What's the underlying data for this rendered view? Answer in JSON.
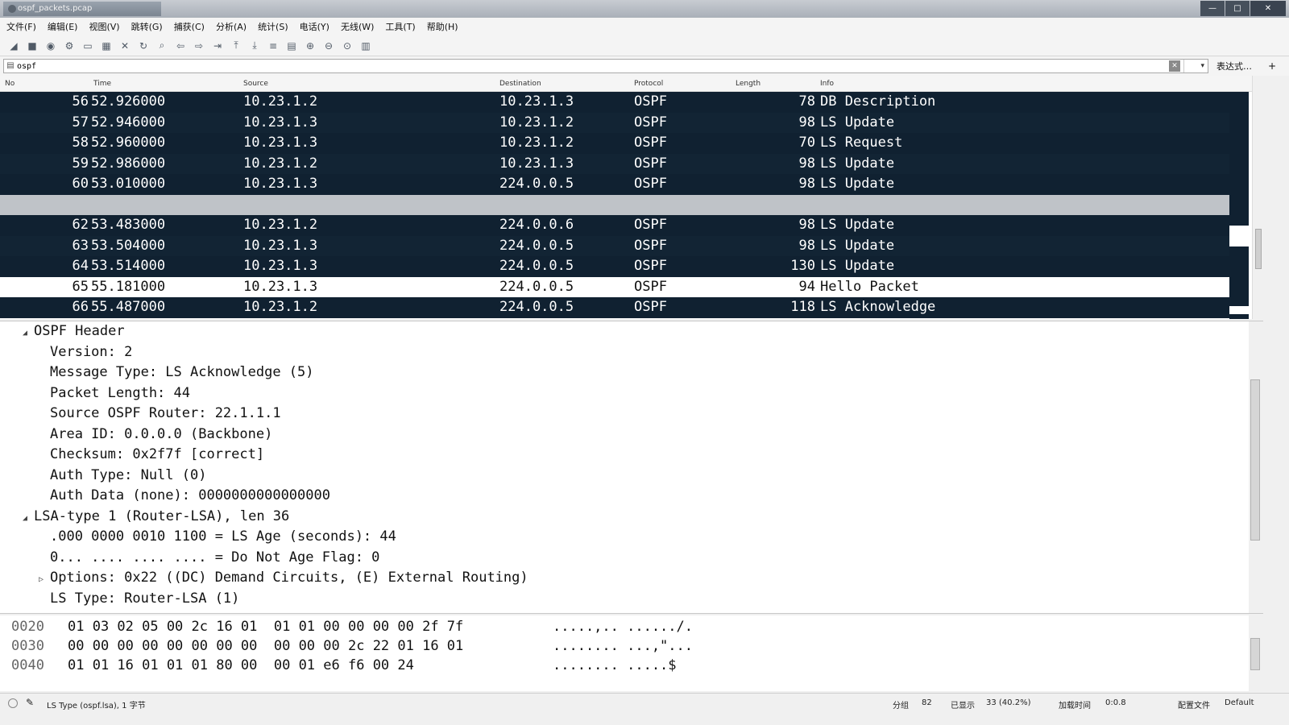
{
  "window": {
    "title": "ospf_packets.pcap",
    "controls": {
      "minimize": "—",
      "maximize": "□",
      "close": "✕"
    }
  },
  "menu": {
    "items": [
      "文件(F)",
      "编辑(E)",
      "视图(V)",
      "跳转(G)",
      "捕获(C)",
      "分析(A)",
      "统计(S)",
      "电话(Y)",
      "无线(W)",
      "工具(T)",
      "帮助(H)"
    ]
  },
  "filter": {
    "value": "ospf",
    "expression_label": "表达式…",
    "plus_label": "+"
  },
  "packet_list": {
    "columns": {
      "no": "No",
      "time": "Time",
      "source": "Source",
      "destination": "Destination",
      "protocol": "Protocol",
      "length": "Length",
      "info": "Info"
    },
    "rows": [
      {
        "no": "56",
        "time": "52.926000",
        "source": "10.23.1.2",
        "destination": "10.23.1.3",
        "protocol": "OSPF",
        "length": "78",
        "info": "DB Description"
      },
      {
        "no": "57",
        "time": "52.946000",
        "source": "10.23.1.3",
        "destination": "10.23.1.2",
        "protocol": "OSPF",
        "length": "98",
        "info": "LS Update"
      },
      {
        "no": "58",
        "time": "52.960000",
        "source": "10.23.1.3",
        "destination": "10.23.1.2",
        "protocol": "OSPF",
        "length": "70",
        "info": "LS Request"
      },
      {
        "no": "59",
        "time": "52.986000",
        "source": "10.23.1.2",
        "destination": "10.23.1.3",
        "protocol": "OSPF",
        "length": "98",
        "info": "LS Update"
      },
      {
        "no": "60",
        "time": "53.010000",
        "source": "10.23.1.3",
        "destination": "224.0.0.5",
        "protocol": "OSPF",
        "length": "98",
        "info": "LS Update"
      },
      {
        "no": "",
        "time": "",
        "source": "",
        "destination": "",
        "protocol": "",
        "length": "",
        "info": ""
      },
      {
        "no": "62",
        "time": "53.483000",
        "source": "10.23.1.2",
        "destination": "224.0.0.6",
        "protocol": "OSPF",
        "length": "98",
        "info": "LS Update"
      },
      {
        "no": "63",
        "time": "53.504000",
        "source": "10.23.1.3",
        "destination": "224.0.0.5",
        "protocol": "OSPF",
        "length": "98",
        "info": "LS Update"
      },
      {
        "no": "64",
        "time": "53.514000",
        "source": "10.23.1.3",
        "destination": "224.0.0.5",
        "protocol": "OSPF",
        "length": "130",
        "info": "LS Update"
      },
      {
        "no": "65",
        "time": "55.181000",
        "source": "10.23.1.3",
        "destination": "224.0.0.5",
        "protocol": "OSPF",
        "length": "94",
        "info": "Hello Packet"
      },
      {
        "no": "66",
        "time": "55.487000",
        "source": "10.23.1.2",
        "destination": "224.0.0.5",
        "protocol": "OSPF",
        "length": "118",
        "info": "LS Acknowledge"
      }
    ]
  },
  "details": {
    "lines": [
      {
        "indent": 1,
        "toggle": "◢",
        "text": "OSPF Header"
      },
      {
        "indent": 2,
        "toggle": "",
        "text": "Version: 2"
      },
      {
        "indent": 2,
        "toggle": "",
        "text": "Message Type: LS Acknowledge (5)"
      },
      {
        "indent": 2,
        "toggle": "",
        "text": "Packet Length: 44"
      },
      {
        "indent": 2,
        "toggle": "",
        "text": "Source OSPF Router: 22.1.1.1"
      },
      {
        "indent": 2,
        "toggle": "",
        "text": "Area ID: 0.0.0.0 (Backbone)"
      },
      {
        "indent": 2,
        "toggle": "",
        "text": "Checksum: 0x2f7f [correct]"
      },
      {
        "indent": 2,
        "toggle": "",
        "text": "Auth Type: Null (0)"
      },
      {
        "indent": 2,
        "toggle": "",
        "text": "Auth Data (none): 0000000000000000"
      },
      {
        "indent": 1,
        "toggle": "◢",
        "text": "LSA-type 1 (Router-LSA), len 36"
      },
      {
        "indent": 2,
        "toggle": "",
        "text": ".000 0000 0010 1100 = LS Age (seconds): 44"
      },
      {
        "indent": 2,
        "toggle": "",
        "text": "0... .... .... .... = Do Not Age Flag: 0"
      },
      {
        "indent": 2,
        "toggle": "▷",
        "text": "Options: 0x22 ((DC) Demand Circuits, (E) External Routing)"
      },
      {
        "indent": 2,
        "toggle": "",
        "text": "LS Type: Router-LSA (1)"
      }
    ]
  },
  "bytes": {
    "rows": [
      {
        "offset": "0020",
        "hex": "01 03 02 05 00 2c 16 01  01 01 00 00 00 00 2f 7f",
        "ascii": ".....,.. ....../."
      },
      {
        "offset": "0030",
        "hex": "00 00 00 00 00 00 00 00  00 00 00 2c 22 01 16 01",
        "ascii": "........ ...,\"..."
      },
      {
        "offset": "0040",
        "hex": "01 01 16 01 01 01 80 00  00 01 e6 f6 00 24",
        "ascii": "........ .....$"
      }
    ]
  },
  "status": {
    "field_info": "LS Type (ospf.lsa), 1 字节",
    "packets_label": "分组",
    "packets": "82",
    "displayed_label": "已显示",
    "displayed": "33 (40.2%)",
    "load_label": "加载时间",
    "load": "0:0.8",
    "profile_label": "配置文件",
    "profile": "Default"
  },
  "colors": {
    "dark_row": "#102131",
    "selected_row": "#bfc3c8",
    "light_row": "#ffffff"
  }
}
